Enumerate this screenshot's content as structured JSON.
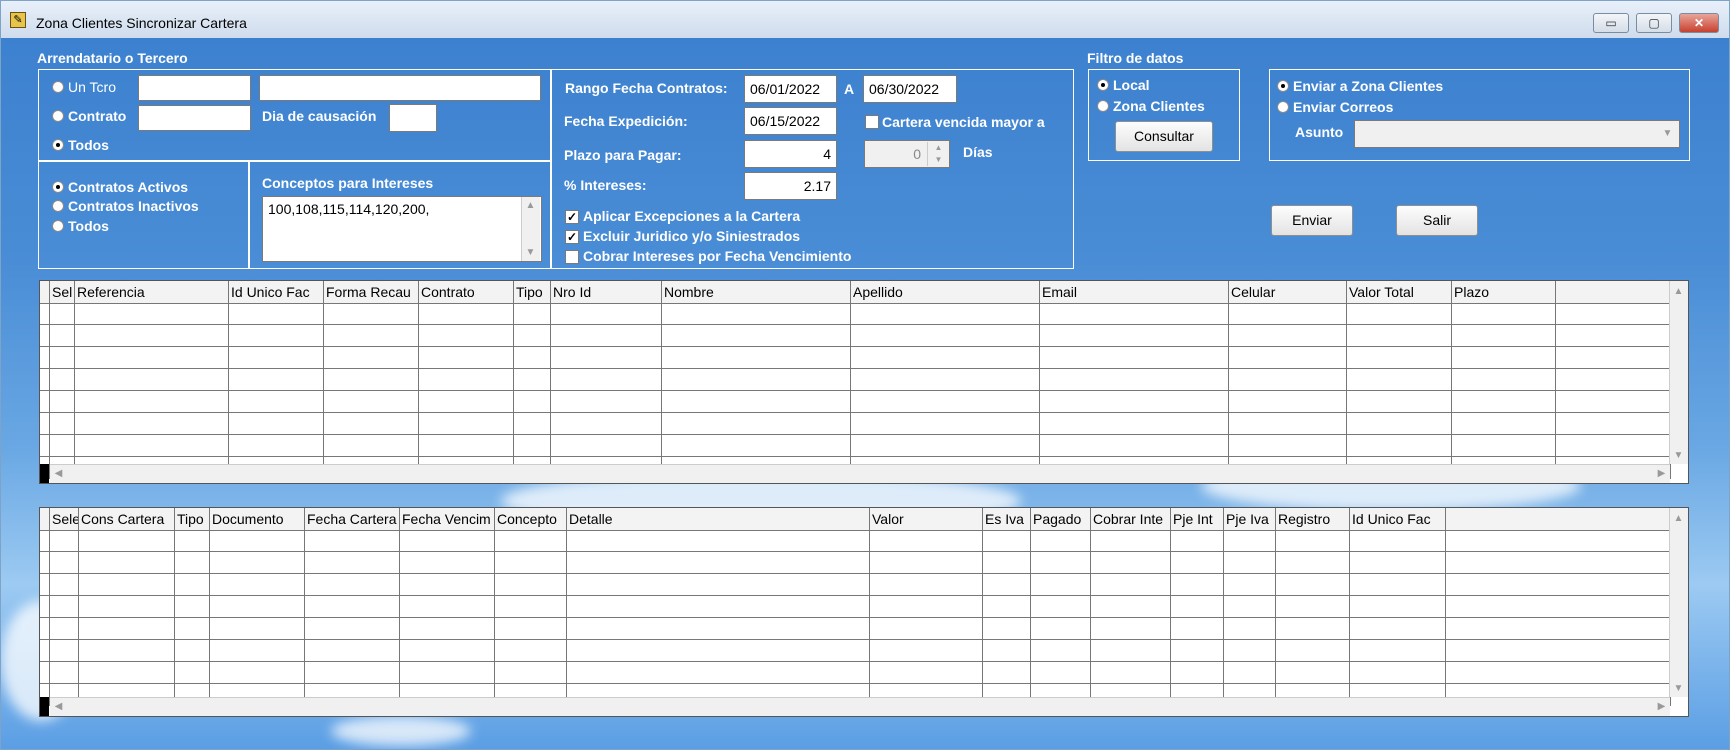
{
  "window": {
    "title": "Zona Clientes Sincronizar Cartera",
    "minimize": "▭",
    "maximize": "▢",
    "close": "✕"
  },
  "arrendatario": {
    "heading": "Arrendatario o Tercero",
    "un_tcro": "Un Tcro",
    "contrato": "Contrato",
    "todos": "Todos",
    "dia_causacion": "Dia de causación",
    "un_tcro_code": "",
    "un_tcro_name": "",
    "contrato_value": "",
    "dia_value": ""
  },
  "estado": {
    "activos": "Contratos Activos",
    "inactivos": "Contratos Inactivos",
    "todos": "Todos"
  },
  "conceptos": {
    "label": "Conceptos para Intereses",
    "value": "100,108,115,114,120,200,"
  },
  "fechas": {
    "rango_label": "Rango Fecha Contratos:",
    "desde": "06/01/2022",
    "a_label": "A",
    "hasta": "06/30/2022",
    "expedicion_label": "Fecha Expedición:",
    "expedicion": "06/15/2022",
    "plazo_label": "Plazo para Pagar:",
    "plazo": "4",
    "intereses_label": "% Intereses:",
    "intereses": "2.17",
    "cartera_vencida_label": "Cartera vencida mayor a",
    "dias_value": "0",
    "dias_label": "Días",
    "aplicar_label": "Aplicar Excepciones a la Cartera",
    "excluir_label": "Excluir Juridico y/o Siniestrados",
    "cobrar_label": "Cobrar Intereses por Fecha Vencimiento"
  },
  "filtro": {
    "heading": "Filtro de datos",
    "local": "Local",
    "zona": "Zona Clientes",
    "consultar": "Consultar"
  },
  "envio": {
    "zona": "Enviar a Zona Clientes",
    "correos": "Enviar Correos",
    "asunto_label": "Asunto",
    "asunto_value": ""
  },
  "actions": {
    "enviar": "Enviar",
    "salir": "Salir"
  },
  "grid1": {
    "columns": [
      "Sel",
      "Referencia",
      "Id Unico Fac",
      "Forma Recau",
      "Contrato",
      "Tipo",
      "Nro Id",
      "Nombre",
      "Apellido",
      "Email",
      "Celular",
      "Valor Total",
      "Plazo"
    ]
  },
  "grid2": {
    "columns": [
      "Sele",
      "Cons Cartera",
      "Tipo",
      "Documento",
      "Fecha Cartera",
      "Fecha Vencim",
      "Concepto",
      "Detalle",
      "Valor",
      "Es Iva",
      "Pagado",
      "Cobrar Inte",
      "Pje Int",
      "Pje Iva",
      "Registro",
      "Id Unico Fac"
    ]
  },
  "colors": {
    "background": "#4a8dd6",
    "title_bar": "#dde7f3",
    "close": "#c8402e"
  }
}
